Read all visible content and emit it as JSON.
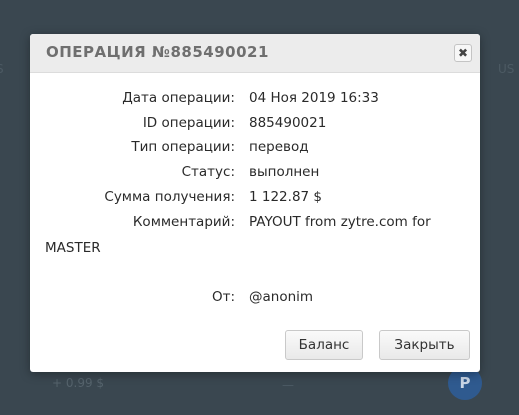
{
  "background": {
    "left_fragment": "S",
    "right_fragment": "US",
    "amount": "+ 0.99 $",
    "dash": "—",
    "badge_letter": "P"
  },
  "modal": {
    "title": "ОПЕРАЦИЯ №885490021",
    "close_symbol": "✖",
    "fields": [
      {
        "label": "Дата операции:",
        "value": "04 Ноя 2019 16:33"
      },
      {
        "label": "ID операции:",
        "value": "885490021"
      },
      {
        "label": "Тип операции:",
        "value": "перевод"
      },
      {
        "label": "Статус:",
        "value": "выполнен"
      },
      {
        "label": "Сумма получения:",
        "value": "1 122.87 $"
      },
      {
        "label": "Комментарий:",
        "value": "PAYOUT from zytre.com for"
      }
    ],
    "comment_continuation": "MASTER",
    "from": {
      "label": "От:",
      "value": "@anonim"
    },
    "buttons": {
      "balance": "Баланс",
      "close": "Закрыть"
    }
  }
}
